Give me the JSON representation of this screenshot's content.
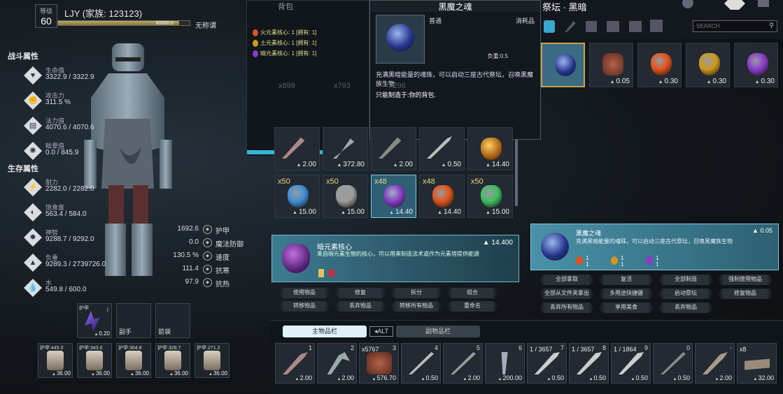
{
  "player": {
    "level_label": "等级",
    "level": "60",
    "name": "LJY (家族: 123123)",
    "xp": "60000.0",
    "title": "无称谓"
  },
  "combat": {
    "header": "战斗属性",
    "stats": [
      {
        "label": "生命值",
        "value": "3322.9 / 3322.9",
        "icon": "heart-icon"
      },
      {
        "label": "攻击力",
        "value": "311.5 %",
        "icon": "fist-icon"
      },
      {
        "label": "法力值",
        "value": "4070.6 / 4070.6",
        "icon": "book-icon"
      },
      {
        "label": "眩晕值",
        "value": "0.0 / 845.9",
        "icon": "dizzy-icon"
      }
    ]
  },
  "survival": {
    "header": "生存属性",
    "stats": [
      {
        "label": "耐力",
        "value": "2282.0 / 2282.0",
        "icon": "stamina-icon"
      },
      {
        "label": "饱食度",
        "value": "563.4 / 584.0",
        "icon": "stomach-icon"
      },
      {
        "label": "神智",
        "value": "9288.7 / 9292.0",
        "icon": "brain-icon"
      },
      {
        "label": "负重",
        "value": "9289.3 / 2739726.0",
        "icon": "weight-icon"
      },
      {
        "label": "水",
        "value": "549.8 / 600.0",
        "icon": "water-icon"
      }
    ]
  },
  "resist": [
    {
      "value": "1692.6",
      "label": "护甲"
    },
    {
      "value": "0.0",
      "label": "魔法防御"
    },
    {
      "value": "130.5 %",
      "label": "速度"
    },
    {
      "value": "111.4",
      "label": "抗寒"
    },
    {
      "value": "97.9",
      "label": "抗热"
    }
  ],
  "equip": {
    "top": [
      {
        "tag": "护甲",
        "num": "I",
        "weight": "0.20",
        "name": ""
      },
      {
        "tag": "",
        "num": "",
        "weight": "",
        "name": "副手"
      },
      {
        "tag": "",
        "num": "",
        "weight": "",
        "name": "箭袋"
      }
    ],
    "armor": [
      {
        "tag": "护甲:445.0",
        "weight": "36.00"
      },
      {
        "tag": "护甲:343.0",
        "weight": "36.00"
      },
      {
        "tag": "护甲:304.8",
        "weight": "36.00"
      },
      {
        "tag": "护甲:328.7",
        "weight": "36.00"
      },
      {
        "tag": "护甲:271.2",
        "weight": "36.00"
      }
    ]
  },
  "backpack": {
    "tab": "背包",
    "mats": [
      {
        "name": "火元素核心: 1 [拥有: 1]",
        "color": "#e2531c"
      },
      {
        "name": "土元素核心: 1 [拥有: 1]",
        "color": "#d09a1c"
      },
      {
        "name": "暗元素核心: 1 [拥有: 1]",
        "color": "#8a3cc9"
      }
    ],
    "faded": [
      "x899",
      "x793",
      "x296"
    ],
    "row1": [
      {
        "q": "",
        "w": "2.00"
      },
      {
        "q": "",
        "w": "372.80"
      },
      {
        "q": "",
        "w": "2.00"
      },
      {
        "q": "",
        "w": "0.50"
      },
      {
        "q": "",
        "w": "14.40"
      }
    ],
    "row2": [
      {
        "q": "x50",
        "w": "15.00",
        "color": "#3d8fd6"
      },
      {
        "q": "x50",
        "w": "15.00",
        "color": "#9c9c9c"
      },
      {
        "q": "x48",
        "w": "14.40",
        "color": "#8a3cc9"
      },
      {
        "q": "x48",
        "w": "14.40",
        "color": "#e2531c"
      },
      {
        "q": "x50",
        "w": "15.00",
        "color": "#3fbf5f"
      }
    ],
    "selected": {
      "name": "暗元素核心",
      "desc": "来自暗元素生物的核心，可以用来制造法术或作为元素塔提供能源",
      "weight": "14.400"
    },
    "buttons": [
      "使用物品",
      "修复",
      "拆分",
      "组合",
      "转移物品",
      "丢弃物品",
      "转移所有物品",
      "重命名"
    ]
  },
  "tooltip": {
    "title": "黑魔之魂",
    "rarity": "普通",
    "type": "消耗品",
    "weight": "负重:0.5",
    "desc": "充满黑暗能量的魂珠，可以启动三座古代祭坛，召唤黑魔族生物",
    "note": "只能制造于:你的背包."
  },
  "altar": {
    "title": "祭坛 · 黑暗",
    "search_placeholder": "SEARCH",
    "items": [
      {
        "w": "",
        "color": "#3b5aa8"
      },
      {
        "w": "0.05",
        "color": "#8a3a2a"
      },
      {
        "w": "0.30",
        "color": "#e2531c"
      },
      {
        "w": "0.30",
        "color": "#d09a1c"
      },
      {
        "w": "0.30",
        "color": "#8a3cc9"
      }
    ],
    "selected": {
      "name": "黑魔之魂",
      "desc": "充满黑暗能量的魂珠，可以启动三座古代祭坛，召唤黑魔族生物",
      "weight": "0.05",
      "mats": [
        {
          "a": "1",
          "b": "1"
        },
        {
          "a": "1",
          "b": "1"
        },
        {
          "a": "1",
          "b": "1"
        }
      ]
    },
    "buttons": [
      "全部拿取",
      "复活",
      "全部制造",
      "强制使用物品",
      "全部从文件夹拿出",
      "多用途快捷键",
      "启动祭坛",
      "修复物品",
      "丢弃所有物品",
      "享用美食",
      "丢弃物品"
    ]
  },
  "hotbar": {
    "tab_main": "主物品栏",
    "alt": "ALT",
    "tab_sub": "副物品栏",
    "slots": [
      {
        "k": "1",
        "d": "",
        "w": "2.00"
      },
      {
        "k": "2",
        "d": "",
        "w": "2.00"
      },
      {
        "k": "3",
        "d": "x5767",
        "w": "576.70"
      },
      {
        "k": "4",
        "d": "",
        "w": "0.50"
      },
      {
        "k": "5",
        "d": "",
        "w": "2.00"
      },
      {
        "k": "6",
        "d": "",
        "w": "200.00"
      },
      {
        "k": "7",
        "d": "1 / 3657",
        "w": "0.50"
      },
      {
        "k": "8",
        "d": "1 / 3657",
        "w": "0.50"
      },
      {
        "k": "9",
        "d": "1 / 1864",
        "w": "0.50"
      },
      {
        "k": "0",
        "d": "",
        "w": "0.50"
      },
      {
        "k": "-",
        "d": "",
        "w": "2.00"
      },
      {
        "k": "",
        "d": "x8",
        "w": "32.00"
      }
    ]
  }
}
